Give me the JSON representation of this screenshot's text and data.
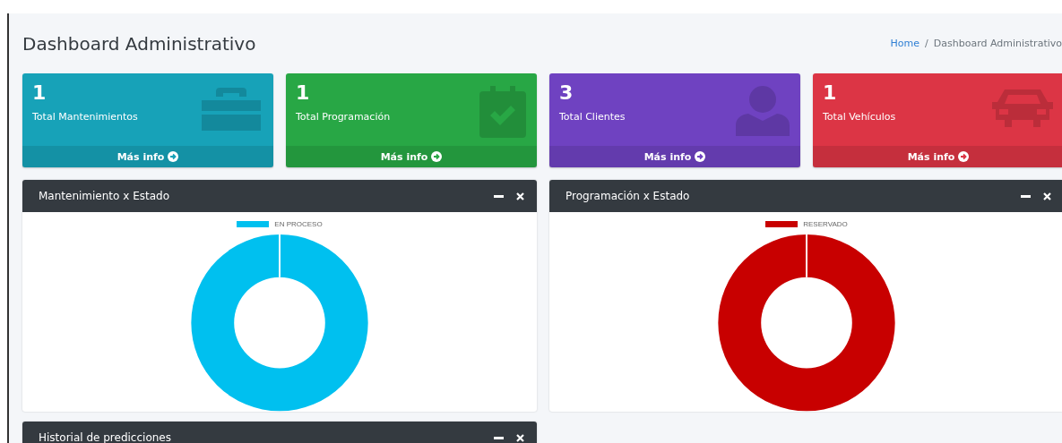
{
  "header": {
    "title": "Dashboard Administrativo",
    "breadcrumb": [
      {
        "label": "Home",
        "kind": "link"
      },
      {
        "label": "/",
        "kind": "separator"
      },
      {
        "label": "Dashboard Administrativo",
        "kind": "current"
      }
    ]
  },
  "info_boxes": [
    {
      "value": "1",
      "label": "Total Mantenimientos",
      "link": "Más info",
      "color": "#17a2b8"
    },
    {
      "value": "1",
      "label": "Total Programación",
      "link": "Más info",
      "color": "#28a745"
    },
    {
      "value": "3",
      "label": "Total Clientes",
      "link": "Más info",
      "color": "#6f42c1"
    },
    {
      "value": "1",
      "label": "Total Vehículos",
      "link": "Más info",
      "color": "#dc3545"
    }
  ],
  "panels": [
    {
      "title": "Mantenimiento x Estado",
      "legend": [
        {
          "label": "EN PROCESO",
          "color": "#00c0ef"
        }
      ]
    },
    {
      "title": "Programación x Estado",
      "legend": [
        {
          "label": "RESERVADO",
          "color": "#c80000"
        }
      ]
    },
    {
      "title": "Historial de predicciones"
    }
  ]
}
